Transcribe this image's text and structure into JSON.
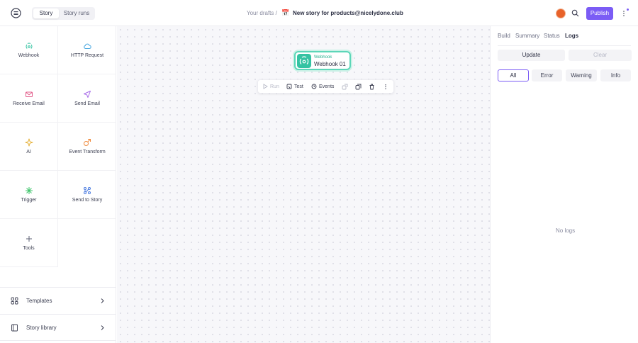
{
  "topbar": {
    "tabs": [
      {
        "label": "Story",
        "active": true
      },
      {
        "label": "Story runs",
        "active": false
      }
    ],
    "breadcrumb": {
      "drafts": "Your drafts /",
      "emoji": "📅",
      "title": "New story for products@nicelydone.club"
    },
    "publish_label": "Publish",
    "icons": [
      "sidebar-toggle-icon",
      "search-icon",
      "more-vertical-icon"
    ],
    "accent_color": "#7b5cf5"
  },
  "palette": {
    "tiles": [
      {
        "label": "Webhook",
        "icon": "webhook-icon",
        "color": "#34c3a2"
      },
      {
        "label": "HTTP Request",
        "icon": "cloud-icon",
        "color": "#4aa8e0"
      },
      {
        "label": "Receive Email",
        "icon": "mail-icon",
        "color": "#e25b8a"
      },
      {
        "label": "Send Email",
        "icon": "send-icon",
        "color": "#a86be8"
      },
      {
        "label": "AI",
        "icon": "sparkle-icon",
        "color": "#e6b23a"
      },
      {
        "label": "Event Transform",
        "icon": "transform-icon",
        "color": "#f08a3c"
      },
      {
        "label": "Trigger",
        "icon": "bolt-icon",
        "color": "#3cc46a"
      },
      {
        "label": "Send to Story",
        "icon": "flow-icon",
        "color": "#4a7be0"
      },
      {
        "label": "Tools",
        "icon": "plus-icon",
        "color": "#5d6074"
      }
    ],
    "links": [
      {
        "label": "Templates",
        "icon": "grid-icon"
      },
      {
        "label": "Story library",
        "icon": "book-icon"
      }
    ]
  },
  "canvas": {
    "node": {
      "type": "Webhook",
      "name": "Webhook 01",
      "color": "#34c3a2"
    },
    "toolbar": {
      "run": "Run",
      "test": "Test",
      "events": "Events"
    }
  },
  "right_panel": {
    "tabs": [
      {
        "label": "Build",
        "active": false
      },
      {
        "label": "Summary",
        "active": false
      },
      {
        "label": "Status",
        "active": false
      },
      {
        "label": "Logs",
        "active": true
      }
    ],
    "update_label": "Update",
    "clear_label": "Clear",
    "filters": [
      {
        "label": "All",
        "active": true
      },
      {
        "label": "Error",
        "active": false
      },
      {
        "label": "Warning",
        "active": false
      },
      {
        "label": "Info",
        "active": false
      }
    ],
    "empty_text": "No logs"
  }
}
